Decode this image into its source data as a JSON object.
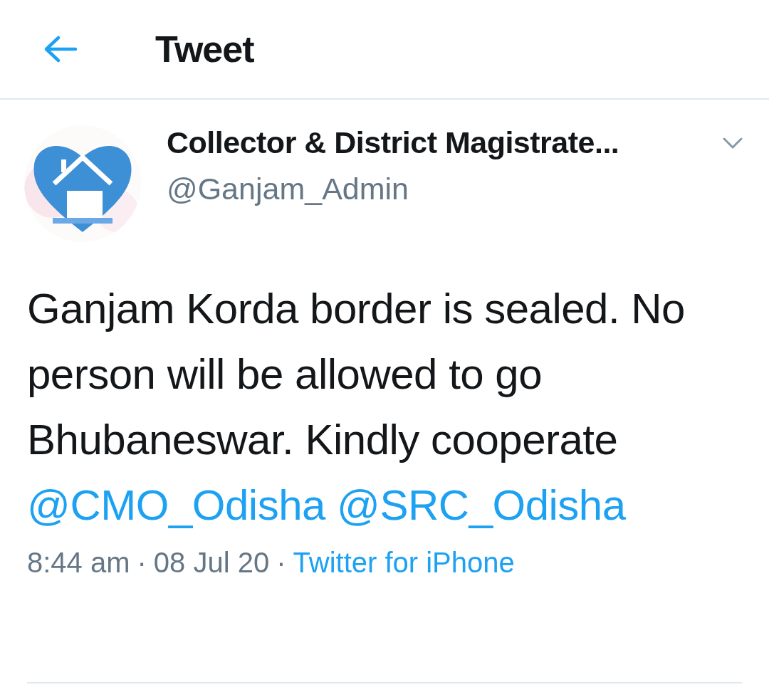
{
  "header": {
    "title": "Tweet"
  },
  "tweet": {
    "author": {
      "name": "Collector & District Magistrate...",
      "handle": "@Ganjam_Admin"
    },
    "text": "Ganjam Korda border is sealed. No person will be allowed to go Bhubaneswar. Kindly cooperate",
    "mentions": [
      "@CMO_Odisha",
      "@SRC_Odisha"
    ],
    "time": "8:44 am",
    "separator_1": "·",
    "date": "08 Jul 20",
    "separator_2": "·",
    "source": "Twitter for iPhone"
  }
}
